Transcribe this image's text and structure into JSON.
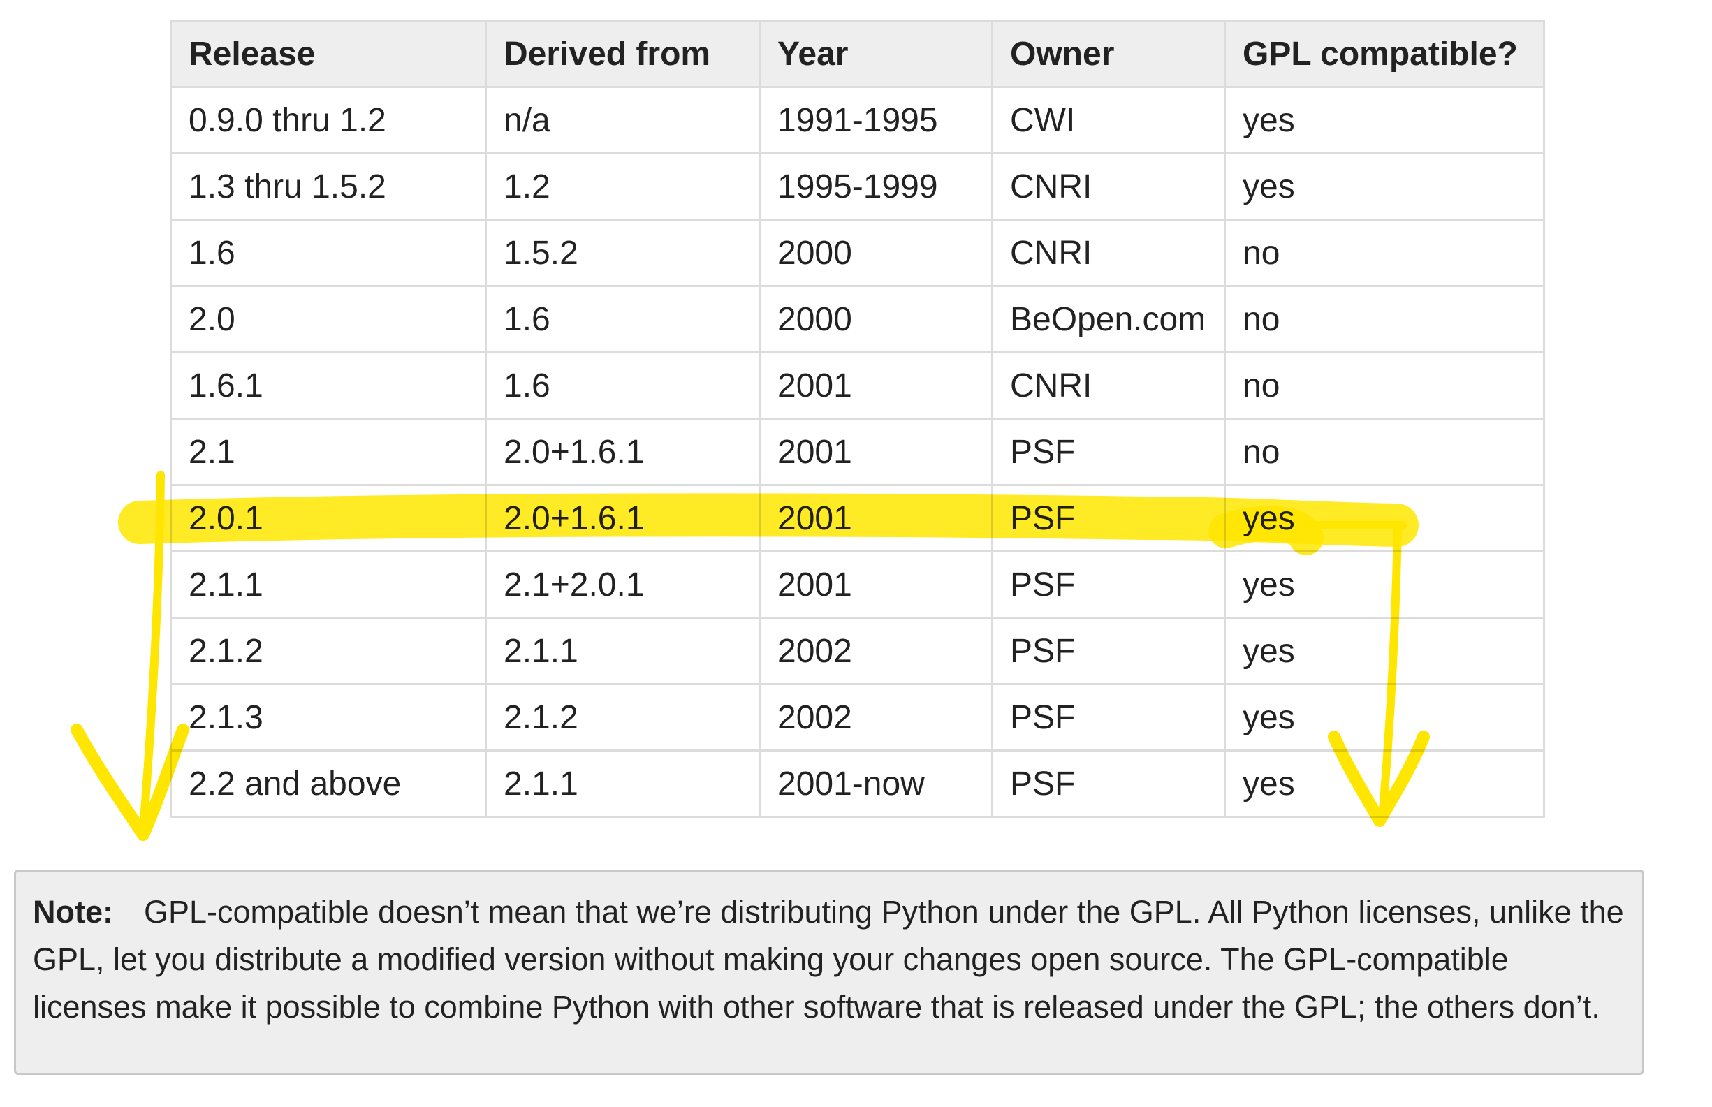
{
  "table": {
    "headers": [
      "Release",
      "Derived from",
      "Year",
      "Owner",
      "GPL compatible?"
    ],
    "rows": [
      [
        "0.9.0 thru 1.2",
        "n/a",
        "1991-1995",
        "CWI",
        "yes"
      ],
      [
        "1.3 thru 1.5.2",
        "1.2",
        "1995-1999",
        "CNRI",
        "yes"
      ],
      [
        "1.6",
        "1.5.2",
        "2000",
        "CNRI",
        "no"
      ],
      [
        "2.0",
        "1.6",
        "2000",
        "BeOpen.com",
        "no"
      ],
      [
        "1.6.1",
        "1.6",
        "2001",
        "CNRI",
        "no"
      ],
      [
        "2.1",
        "2.0+1.6.1",
        "2001",
        "PSF",
        "no"
      ],
      [
        "2.0.1",
        "2.0+1.6.1",
        "2001",
        "PSF",
        "yes"
      ],
      [
        "2.1.1",
        "2.1+2.0.1",
        "2001",
        "PSF",
        "yes"
      ],
      [
        "2.1.2",
        "2.1.1",
        "2002",
        "PSF",
        "yes"
      ],
      [
        "2.1.3",
        "2.1.2",
        "2002",
        "PSF",
        "yes"
      ],
      [
        "2.2 and above",
        "2.1.1",
        "2001-now",
        "PSF",
        "yes"
      ]
    ]
  },
  "note": {
    "title": "Note:",
    "text": "GPL-compatible doesn’t mean that we’re distributing Python under the GPL. All Python licenses, unlike the GPL, let you distribute a modified version without making your changes open source. The GPL-compatible licenses make it possible to combine Python with other software that is released under the GPL; the others don’t."
  },
  "annotation": {
    "color": "#ffe600",
    "highlighted_release": "2.0.1"
  }
}
